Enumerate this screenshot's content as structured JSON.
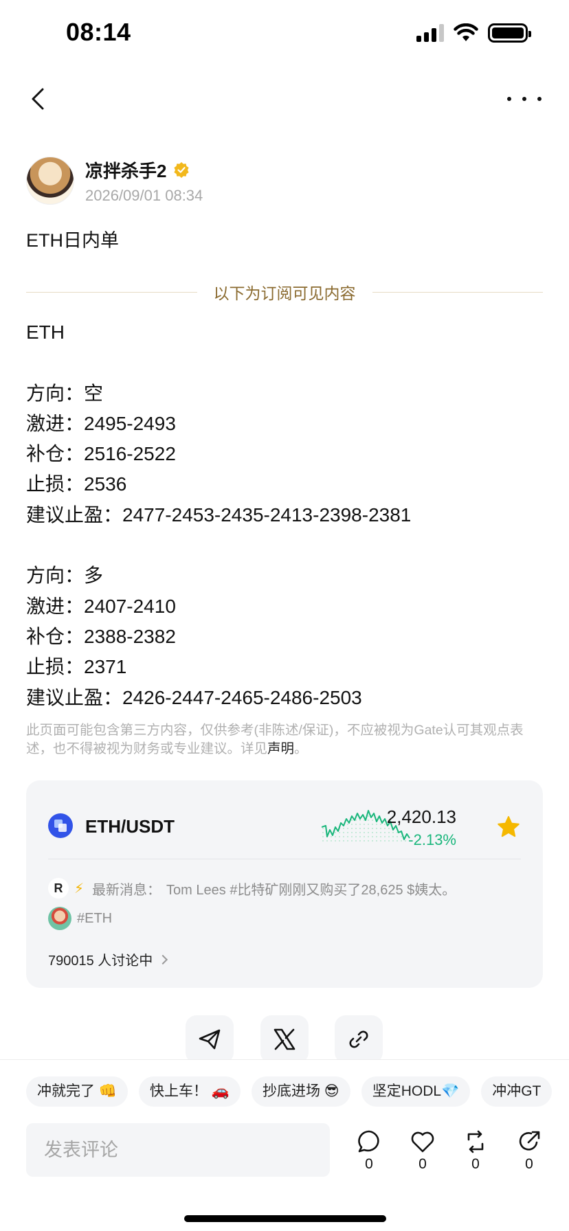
{
  "status_bar": {
    "time": "08:14"
  },
  "nav": {
    "back_icon": "chevron-left-icon",
    "more_icon": "more-dots-icon"
  },
  "author": {
    "name": "凉拌杀手2",
    "time": "2026/09/01 08:34",
    "verified_icon": "verified-badge-icon"
  },
  "post": {
    "title": "ETH日内单",
    "divider_label": "以下为订阅可见内容",
    "lines": [
      "ETH",
      "",
      "方向：空",
      "激进：2495-2493",
      "补仓：2516-2522",
      "止损：2536",
      "建议止盈：2477-2453-2435-2413-2398-2381",
      "",
      "方向：多",
      "激进：2407-2410",
      "补仓：2388-2382",
      "止损：2371",
      "建议止盈：2426-2447-2465-2486-2503"
    ],
    "disclaimer": "此页面可能包含第三方内容，仅供参考(非陈述/保证)，不应被视为Gate认可其观点表述，也不得被视为财务或专业建议。详见",
    "disclaimer_link": "声明",
    "disclaimer_end": "。"
  },
  "market": {
    "pair": "ETH/USDT",
    "price": "2,420.13",
    "change": "-2.13%",
    "change_color": "#19b67b",
    "news_label": "最新消息：",
    "news_text": "Tom Lees #比特矿刚刚又购买了28,625 $姨太。",
    "tag": "#ETH",
    "discussion": "790015 人讨论中"
  },
  "share": {
    "telegram_icon": "send-icon",
    "x_icon": "x-logo-icon",
    "link_icon": "link-icon"
  },
  "quick_replies": [
    "冲就完了 👊",
    "快上车！ 🚗",
    "抄底进场 😎",
    "坚定HODL💎",
    "冲冲GT"
  ],
  "comment": {
    "placeholder": "发表评论"
  },
  "actions": {
    "comment_count": "0",
    "like_count": "0",
    "repost_count": "0",
    "share_count": "0"
  }
}
